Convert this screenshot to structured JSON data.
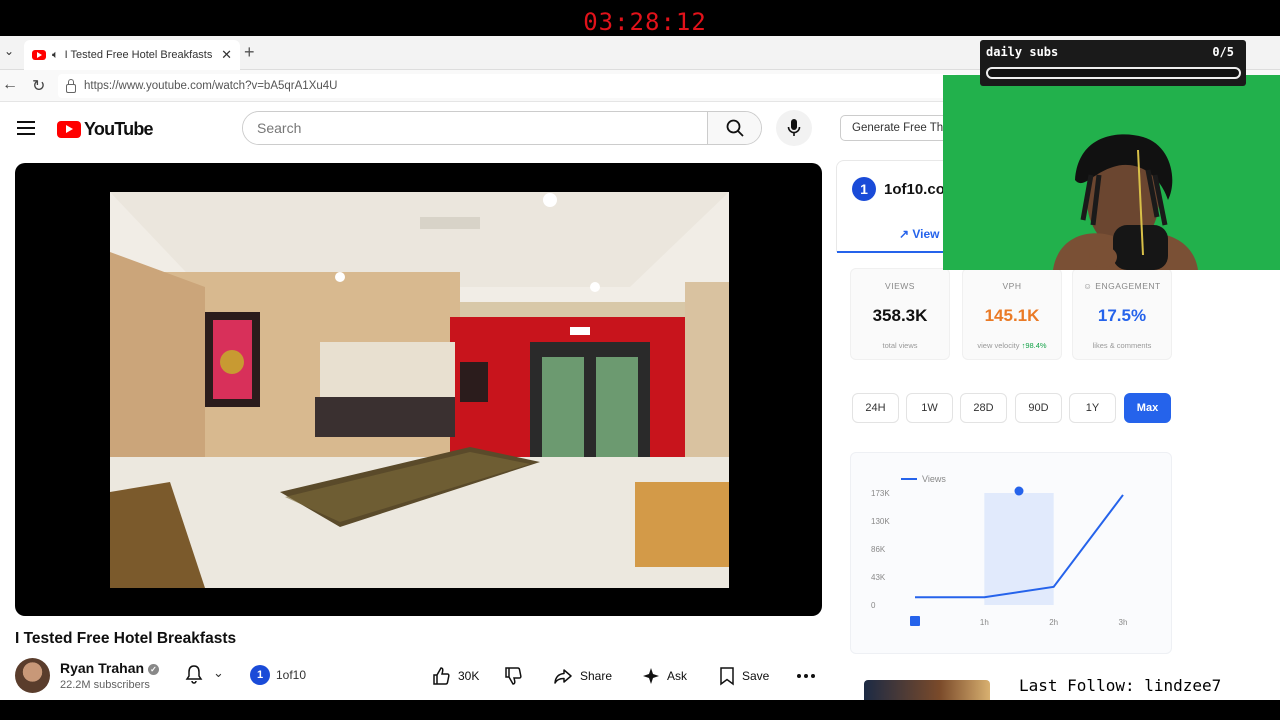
{
  "overlay": {
    "timer": "03:28:12",
    "subs_goal": {
      "label": "daily subs",
      "count": "0/5",
      "progress": 0
    },
    "last_follow": "Last Follow: lindzee7"
  },
  "browser": {
    "tab_title": "I Tested Free Hotel Breakfasts",
    "url": "https://www.youtube.com/watch?v=bA5qrA1Xu4U"
  },
  "masthead": {
    "logo_text": "YouTube",
    "search_placeholder": "Search",
    "generate_button": "Generate Free Thu"
  },
  "video": {
    "title": "I Tested Free Hotel Breakfasts",
    "channel": "Ryan Trahan",
    "subscribers": "22.2M subscribers",
    "extension_label": "1of10",
    "likes": "30K",
    "share": "Share",
    "ask": "Ask",
    "save": "Save"
  },
  "panel": {
    "brand": "1of10.co",
    "tab": "View",
    "stats": [
      {
        "label": "VIEWS",
        "value": "358.3K",
        "sub": "total views",
        "color": "#111111"
      },
      {
        "label": "VPH",
        "value": "145.1K",
        "sub": "view velocity",
        "sub_extra": "↑98.4%",
        "color": "#ea7a25"
      },
      {
        "label": "☺ ENGAGEMENT",
        "value": "17.5%",
        "sub": "likes & comments",
        "color": "#2563eb"
      }
    ],
    "ranges": [
      "24H",
      "1W",
      "28D",
      "90D",
      "1Y",
      "Max"
    ],
    "active_range": "Max"
  },
  "chart_data": {
    "type": "line",
    "legend": "Views",
    "x": [
      "0",
      "1h",
      "2h",
      "3h"
    ],
    "y_ticks": [
      "173K",
      "130K",
      "86K",
      "43K",
      "0"
    ],
    "ylim": [
      0,
      173000
    ],
    "series": [
      {
        "name": "Views",
        "points": [
          [
            0,
            12000
          ],
          [
            1,
            12000
          ],
          [
            2,
            28000
          ],
          [
            3,
            170000
          ]
        ]
      }
    ],
    "highlight_range": [
      1,
      2
    ],
    "marker_x": 1.5,
    "color": "#2563eb"
  }
}
